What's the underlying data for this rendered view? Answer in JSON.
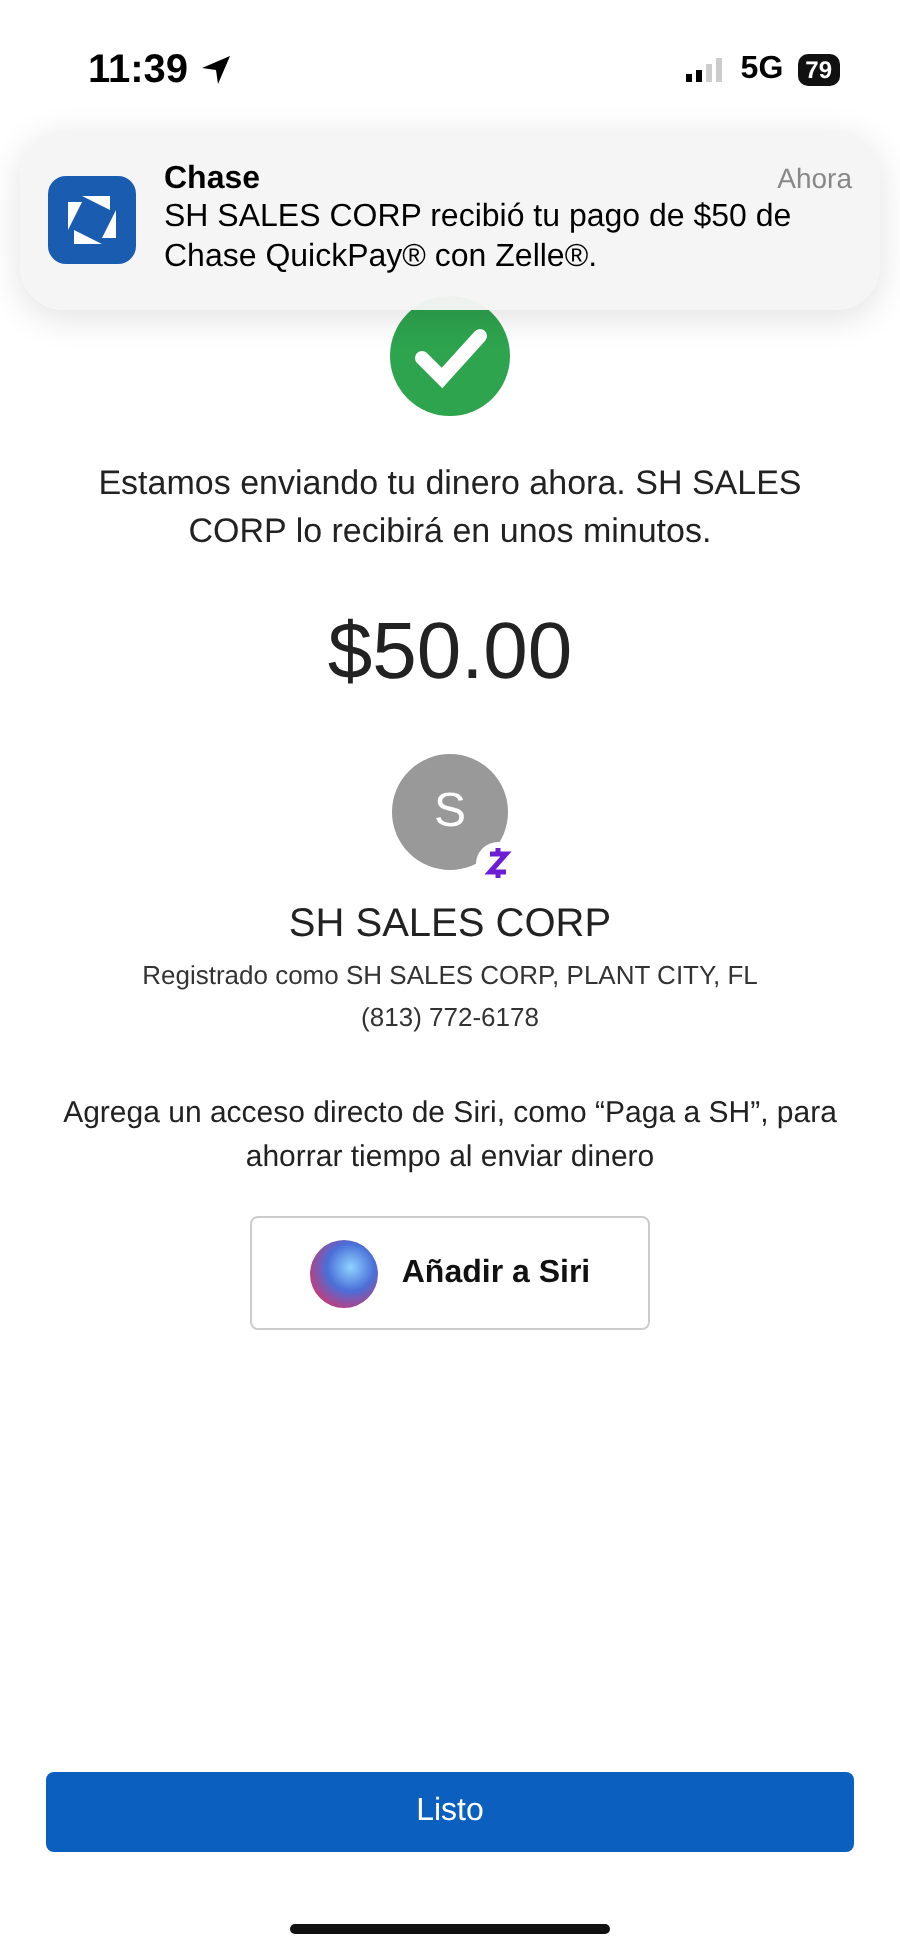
{
  "status_bar": {
    "time": "11:39",
    "network": "5G",
    "battery": "79"
  },
  "notification": {
    "app": "Chase",
    "time": "Ahora",
    "message": "SH SALES CORP recibió tu pago de $50 de Chase QuickPay® con Zelle®."
  },
  "message": "Estamos enviando tu dinero ahora. SH SALES CORP lo recibirá en unos minutos.",
  "amount": "$50.00",
  "recipient": {
    "initial": "S",
    "name": "SH SALES CORP",
    "registered": "Registrado como SH SALES CORP, PLANT CITY, FL",
    "phone": "(813) 772-6178"
  },
  "siri_hint": "Agrega un acceso directo de Siri, como “Paga a SH”, para ahorrar tiempo al enviar dinero",
  "siri_button": "Añadir a Siri",
  "done_button": "Listo"
}
